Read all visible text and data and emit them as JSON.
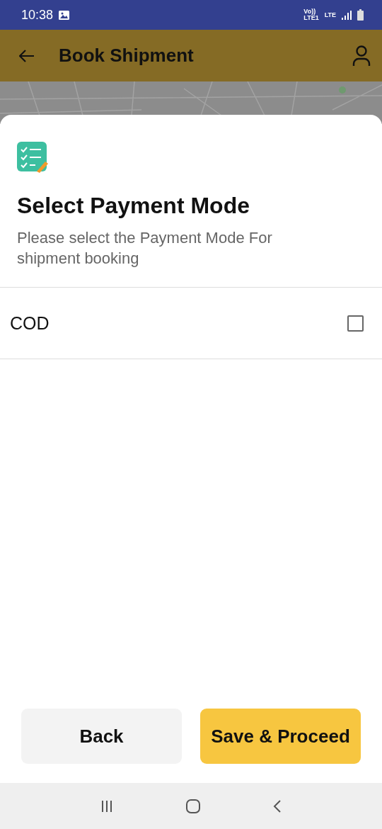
{
  "status_bar": {
    "time": "10:38",
    "network_texts": [
      "Vo))",
      "LTE1",
      "LTE"
    ]
  },
  "app_bar": {
    "title": "Book Shipment"
  },
  "sheet": {
    "title": "Select Payment Mode",
    "subtitle": "Please select the Payment Mode For shipment booking",
    "options": [
      {
        "label": "COD",
        "checked": false
      }
    ]
  },
  "buttons": [
    {
      "label": "Back",
      "kind": "secondary"
    },
    {
      "label": "Save & Proceed",
      "kind": "primary"
    }
  ]
}
